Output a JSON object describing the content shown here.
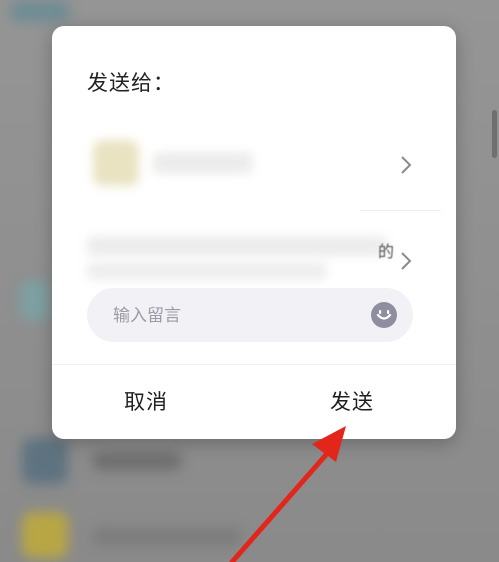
{
  "dialog": {
    "title": "发送给：",
    "recipients": [
      {
        "name_blurred": true
      },
      {
        "residual_text": "的"
      }
    ],
    "message_input": {
      "placeholder": "输入留言",
      "value": ""
    },
    "buttons": {
      "cancel": "取消",
      "send": "发送"
    }
  },
  "annotation": {
    "arrow_color": "#e3261c",
    "target": "send-button"
  },
  "colors": {
    "overlay": "#8d8d8d",
    "dialog_bg": "#ffffff",
    "input_bg": "#f2f2f6",
    "emoji_icon": "#8f8ea1"
  }
}
